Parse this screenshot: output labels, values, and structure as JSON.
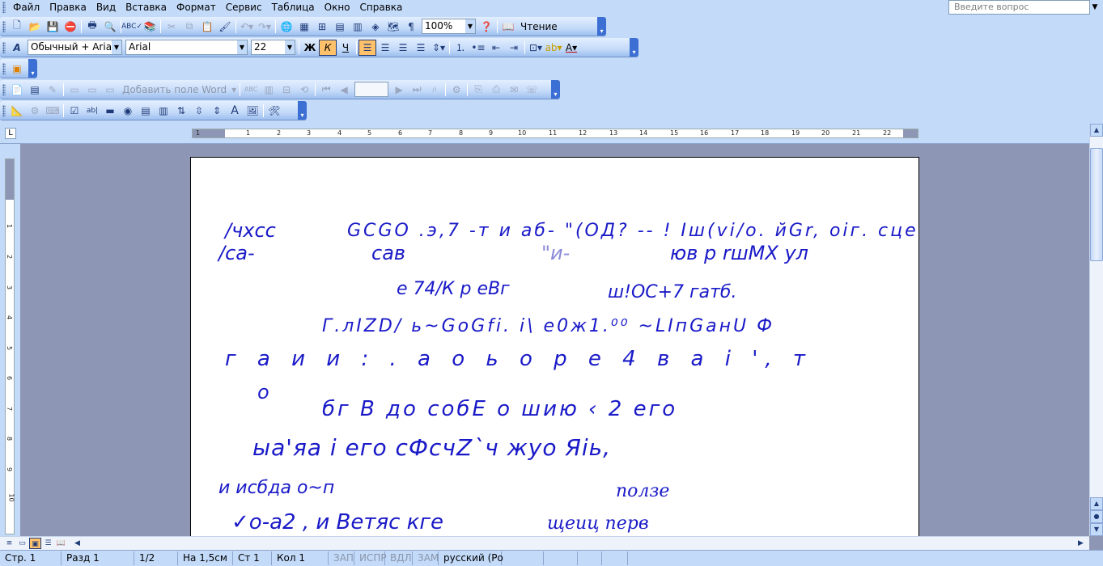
{
  "menu": {
    "items": [
      "Файл",
      "Правка",
      "Вид",
      "Вставка",
      "Формат",
      "Сервис",
      "Таблица",
      "Окно",
      "Справка"
    ],
    "ask_placeholder": "Введите вопрос"
  },
  "standard_toolbar": {
    "zoom": "100%",
    "read_label": "Чтение"
  },
  "format_toolbar": {
    "style": "Обычный + Arial, .",
    "font": "Arial",
    "size": "22",
    "bold": "Ж",
    "italic": "К",
    "underline": "Ч"
  },
  "mailmerge_toolbar": {
    "add_field_label": "Добавить поле Word"
  },
  "ruler": {
    "marks": [
      "1",
      "1",
      "2",
      "3",
      "4",
      "5",
      "6",
      "7",
      "8",
      "9",
      "10",
      "11",
      "12",
      "13",
      "14",
      "15",
      "16",
      "17",
      "18",
      "19",
      "20",
      "21",
      "22"
    ],
    "vmarks": [
      "1",
      "2",
      "3",
      "4",
      "5",
      "6",
      "7",
      "8",
      "9",
      "10"
    ]
  },
  "document": {
    "lines": [
      {
        "text": "/чхсс",
        "size": 24
      },
      {
        "text": "GCGO .э,7 -т и аб- \"(ОД? -- ! Iш(vi/o. йGr, oiг. сце-",
        "size": 22
      },
      {
        "text": "/са-",
        "size": 24
      },
      {
        "text": "сав",
        "size": 24
      },
      {
        "text": "\"и-",
        "size": 24
      },
      {
        "text": "юв р rшМХ ул",
        "size": 24
      },
      {
        "text": "е 74/К р еВг",
        "size": 22
      },
      {
        "text": "ш!ОС+7 гатб.",
        "size": 22
      },
      {
        "text": "Г.лIZD/  ь~GoGfi. i\\ е0ж1.⁰⁰  ~LIпGaнU  Ф",
        "size": 22
      },
      {
        "text": "г а и и : .   а о ь о р е   4 в а i      ', т",
        "size": 26
      },
      {
        "text": "о",
        "size": 24
      },
      {
        "text": "бг В   до собЕ          о шию          ‹ 2 его",
        "size": 26
      },
      {
        "text": "ыа'яа i его сФсчZ`ч жуо Яiь,",
        "size": 28
      },
      {
        "text": "и исбда о~п",
        "size": 22
      },
      {
        "text": "ползе",
        "size": 22
      },
      {
        "text": "✓о-а2 , и Ветяс кге",
        "size": 26
      },
      {
        "text": "щеиц  перв",
        "size": 22
      }
    ]
  },
  "status": {
    "page": "Стр. 1",
    "section": "Разд 1",
    "pages": "1/2",
    "at": "На 1,5см",
    "line": "Ст 1",
    "col": "Кол 1",
    "rec": "ЗАП",
    "trk": "ИСПР",
    "ext": "ВДЛ",
    "ovr": "ЗАМ",
    "lang": "русский (Ро"
  }
}
